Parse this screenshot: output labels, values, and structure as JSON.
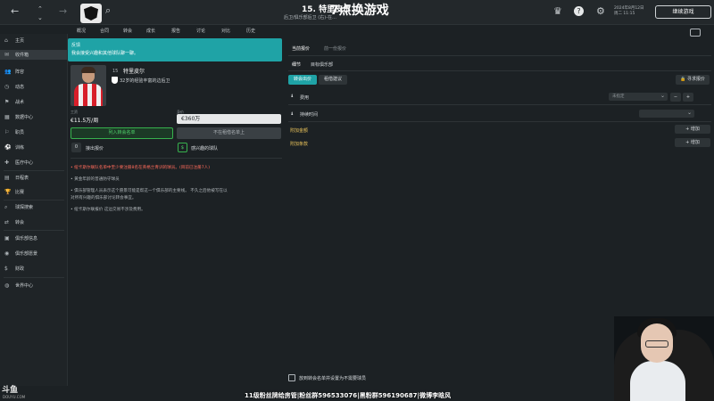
{
  "topbar": {
    "player_title": "15. 特里皮尔",
    "overlay_title": "7点换游戏",
    "subtitle": "后卫/俱乐部后卫 (右)-在…",
    "date_line1": "2024年8月12日",
    "date_line2": "周二 11:15",
    "continue_label": "继续游戏"
  },
  "nav": [
    "概况",
    "合同",
    "转会",
    "成长",
    "报告",
    "讨论",
    "对比",
    "历史"
  ],
  "sidebar": [
    {
      "icon": "⌂",
      "label": "主页"
    },
    {
      "icon": "✉",
      "label": "收件箱",
      "active": true
    },
    {
      "icon": "👥",
      "label": "阵容"
    },
    {
      "icon": "◷",
      "label": "动态"
    },
    {
      "icon": "⚑",
      "label": "战术"
    },
    {
      "icon": "▦",
      "label": "数据中心"
    },
    {
      "icon": "⚐",
      "label": "职员"
    },
    {
      "icon": "⚽",
      "label": "训练"
    },
    {
      "icon": "✚",
      "label": "医疗中心"
    },
    {
      "icon": "▤",
      "label": "日程表"
    },
    {
      "icon": "🏆",
      "label": "比赛"
    },
    {
      "icon": "⌕",
      "label": "球探搜索"
    },
    {
      "icon": "⇄",
      "label": "转会"
    },
    {
      "icon": "▣",
      "label": "俱乐部信息"
    },
    {
      "icon": "◉",
      "label": "俱乐部愿景"
    },
    {
      "icon": "$",
      "label": "财政"
    },
    {
      "icon": "◍",
      "label": "世界中心"
    }
  ],
  "alert": {
    "title": "反馈",
    "text": "我会接受兴趣和其他球队聊一聊。"
  },
  "player": {
    "number": "15",
    "name": "特里皮尔",
    "desc": "32岁的经验丰富的边后卫",
    "wage_label": "工资",
    "wage": "€11.5万/周",
    "value_label": "身价",
    "value": "€360万",
    "transfer_list_btn": "列入转会名单",
    "loan_list_btn": "不在租借名单上",
    "offers_count": "0",
    "offers_label": "接出报价",
    "interested_label": "感兴趣的球队"
  },
  "notes": {
    "warning": "• 纽卡斯尔联队名单中至少要注册8名在英格兰青训的球员。(目前已注册7人)",
    "n1": "• 黄金年龄的普通防守球员",
    "n2": "• 俱乐部管理人员表示这个愿景可能是帮这一个俱乐部的主要线。 不久之后他被写在以",
    "n3": "  对所有兴趣的俱乐部讨论转会事宜。",
    "n4": "• 纽卡斯尔联报价 这边交易不涉及费用。"
  },
  "right": {
    "tab_active": "当前报价",
    "tab_other": "前一份报价",
    "subtab1": "细节",
    "subtab2": "目标俱乐部",
    "pill_active": "转会出价",
    "pill_other": "租借建议",
    "propose_btn": "寻求报价",
    "fee_label": "费用",
    "fee_placeholder": "未指定",
    "duration_label": "持续时间",
    "extra_fee": "附加金额",
    "extra_terms": "附加条款",
    "add_btn": "+ 增加",
    "bottom_check": "放到转会名单并设置为不需要球员"
  },
  "overlay_banner": "11级粉丝牌给房管|粉丝群596533076|黑粉群596190687|微博李晗风",
  "douyu": "斗鱼",
  "douyu_sub": "DOUYU.COM"
}
